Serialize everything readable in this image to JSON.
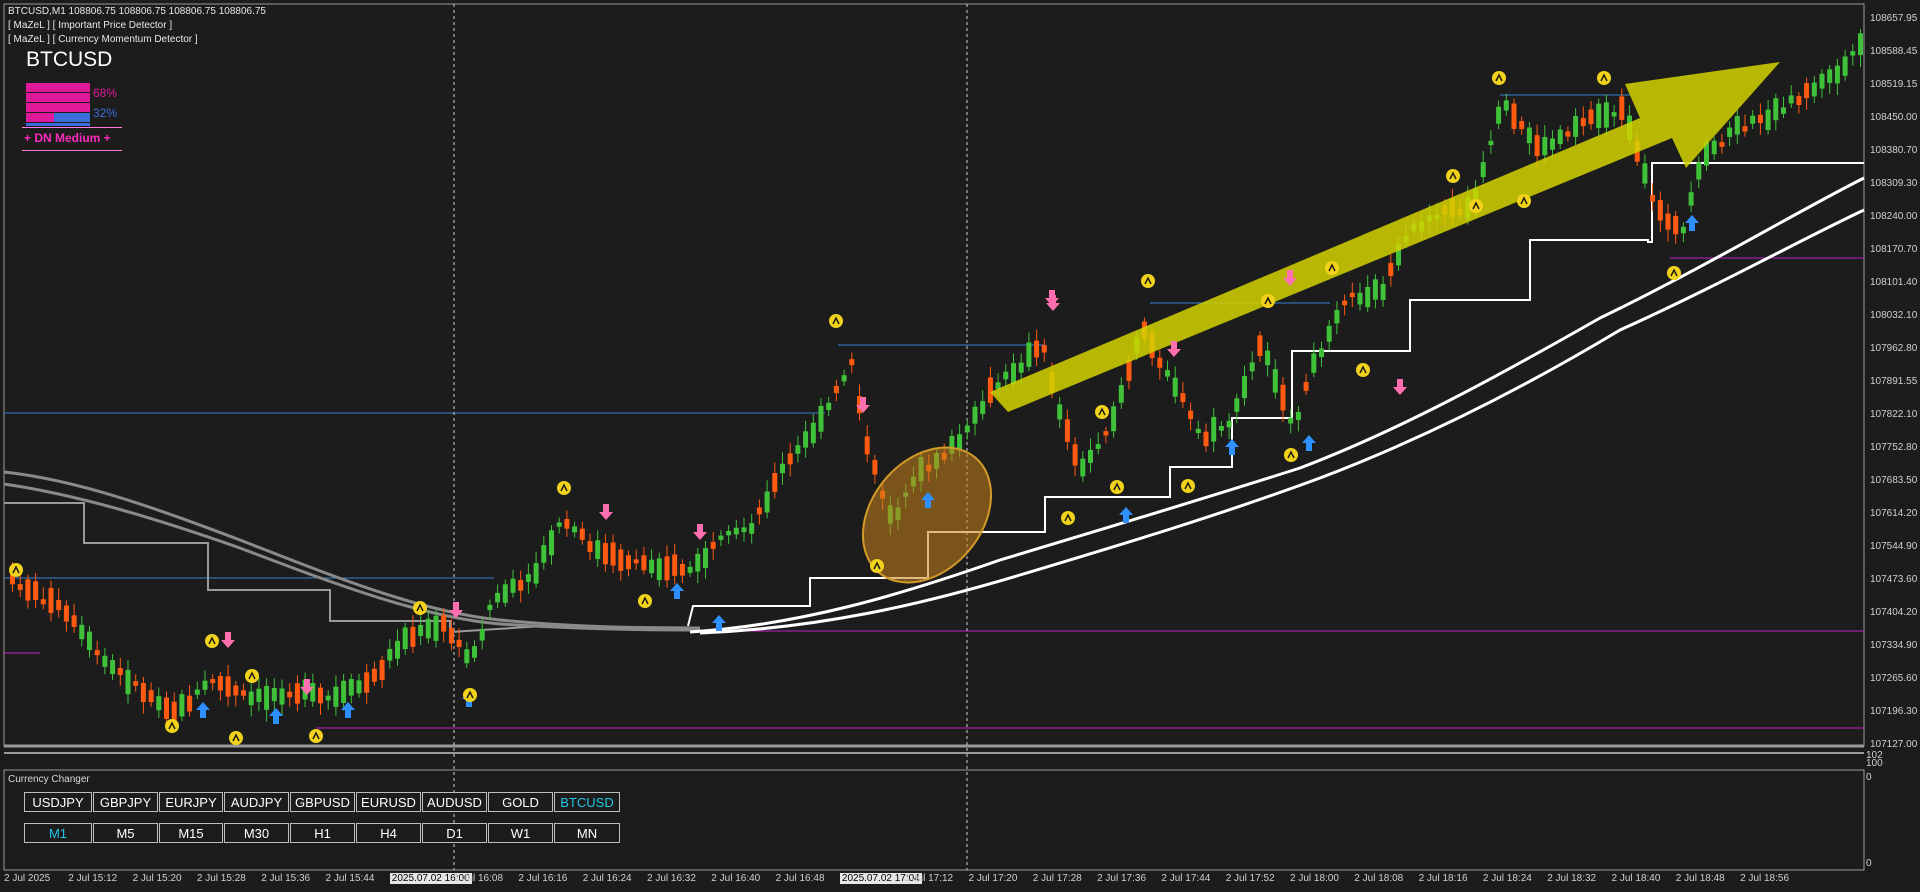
{
  "header": {
    "title_line": "BTCUSD,M1  108806.75 108806.75 108806.75 108806.75",
    "indicator_1": "[ MaZeL ] [ Important Price Detector ]",
    "indicator_2": "[ MaZeL ] [ Currency Momentum Detector ]",
    "symbol": "BTCUSD"
  },
  "strength": {
    "bear_pct": "68%",
    "bull_pct": "32%",
    "bear_color": "#e0189a",
    "bull_color": "#3a6dd8",
    "signal": "+ DN Medium +"
  },
  "currency_panel": {
    "title": "Currency Changer",
    "symbols": [
      "USDJPY",
      "GBPJPY",
      "EURJPY",
      "AUDJPY",
      "GBPUSD",
      "EURUSD",
      "AUDUSD",
      "GOLD",
      "BTCUSD"
    ],
    "active_symbol": "BTCUSD",
    "timeframes": [
      "M1",
      "M5",
      "M15",
      "M30",
      "H1",
      "H4",
      "D1",
      "W1",
      "MN"
    ],
    "active_timeframe": "M1"
  },
  "price_axis": [
    "108657.95",
    "108588.45",
    "108519.15",
    "108450.00",
    "108380.70",
    "108309.30",
    "108240.00",
    "108170.70",
    "108101.40",
    "108032.10",
    "107962.80",
    "107891.55",
    "107822.10",
    "107752.80",
    "107683.50",
    "107614.20",
    "107544.90",
    "107473.60",
    "107404.20",
    "107334.90",
    "107265.60",
    "107196.30",
    "107127.00"
  ],
  "sub_axis": {
    "top_a": "102",
    "top_b": "100",
    "mid": "0",
    "bottom": "0"
  },
  "time_axis": [
    "2 Jul 2025",
    "2 Jul 15:12",
    "2 Jul 15:20",
    "2 Jul 15:28",
    "2 Jul 15:36",
    "2 Jul 15:44",
    "2025.07.02 16:00",
    "2 Jul 16:08",
    "2 Jul 16:16",
    "2 Jul 16:24",
    "2 Jul 16:32",
    "2 Jul 16:40",
    "2 Jul 16:48",
    "2025.07.02 17:04",
    "2 Jul 17:12",
    "2 Jul 17:20",
    "2 Jul 17:28",
    "2 Jul 17:36",
    "2 Jul 17:44",
    "2 Jul 17:52",
    "2 Jul 18:00",
    "2 Jul 18:08",
    "2 Jul 18:16",
    "2 Jul 18:24",
    "2 Jul 18:32",
    "2 Jul 18:40",
    "2 Jul 18:48",
    "2 Jul 18:56"
  ],
  "colors": {
    "background": "#1c1c1c",
    "bull_candle": "#3fc23a",
    "bear_candle": "#ff5a10",
    "arrow_up": "#2e8fff",
    "arrow_down": "#ff6fb0",
    "marker": "#f2d21a",
    "trend_arrow": "#d4d400",
    "highlight_ellipse": "#c8841a"
  }
}
